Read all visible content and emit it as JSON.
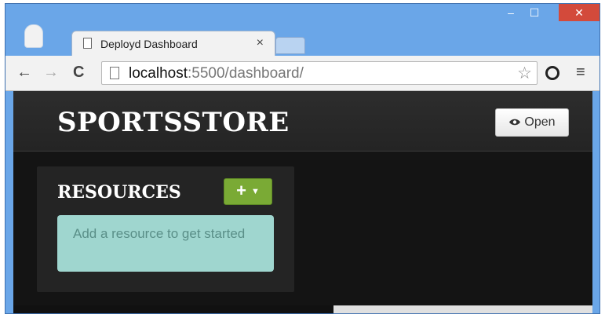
{
  "window": {
    "minimize_label": "–",
    "maximize_label": "☐",
    "close_label": "✕"
  },
  "tab": {
    "title": "Deployd Dashboard",
    "close_label": "×"
  },
  "toolbar": {
    "back_label": "←",
    "forward_label": "→",
    "reload_label": "C",
    "url_host": "localhost",
    "url_rest": ":5500/dashboard/",
    "star_label": "☆",
    "menu_label": "≡"
  },
  "page": {
    "brand": "SPORTSSTORE",
    "open_button": "Open",
    "resources_title": "RESOURCES",
    "add_button": "+",
    "add_caret": "▼",
    "empty_message": "Add a resource to get started"
  },
  "icons": {
    "page": "page-icon",
    "eye": "eye-icon",
    "star": "star-icon",
    "menu": "hamburger-icon",
    "extension": "extension-icon"
  },
  "colors": {
    "chrome_frame": "#6aa6e8",
    "window_close": "#d34a3b",
    "page_bg": "#141414",
    "add_button": "#7aaa35",
    "alert_bg": "#9fd6cf"
  }
}
